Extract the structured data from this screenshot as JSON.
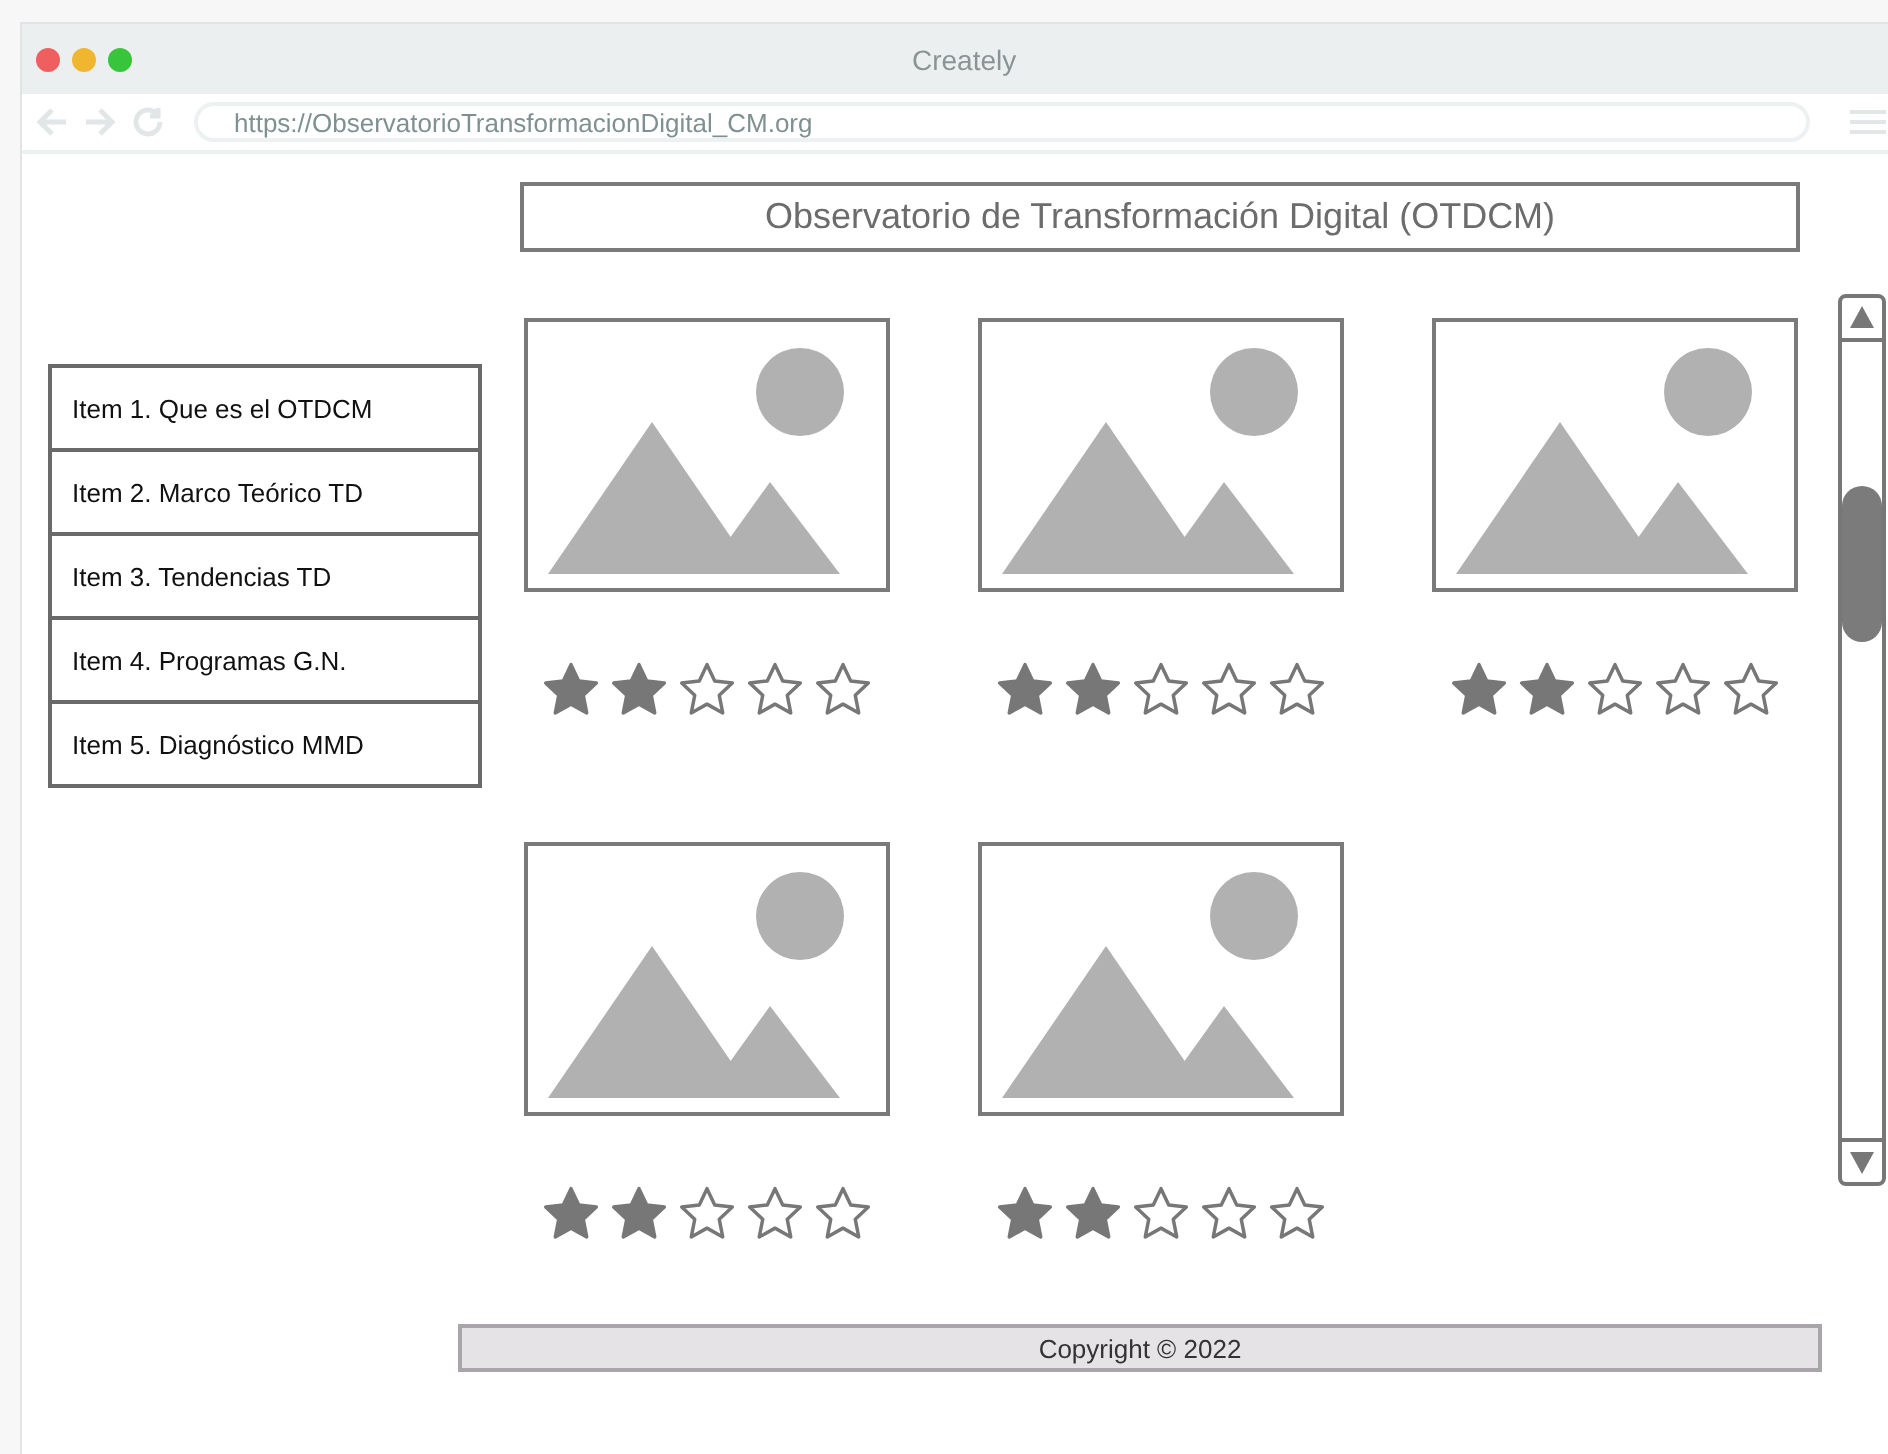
{
  "window": {
    "title": "Creately"
  },
  "address_bar": {
    "url": "https://ObservatorioTransformacionDigital_CM.org"
  },
  "heading": "Observatorio de Transformación Digital (OTDCM)",
  "menu": {
    "items": [
      "Item 1. Que es el OTDCM",
      "Item 2. Marco Teórico TD",
      "Item 3. Tendencias TD",
      "Item 4. Programas G.N.",
      "Item 5. Diagnóstico MMD"
    ]
  },
  "cards": [
    {
      "kind": "picture",
      "stars": 2
    },
    {
      "kind": "picture",
      "stars": 2
    },
    {
      "kind": "picture",
      "stars": 2
    },
    {
      "kind": "picture",
      "stars": 2
    },
    {
      "kind": "picture",
      "stars": 2
    }
  ],
  "footer": "Copyright © 2022"
}
